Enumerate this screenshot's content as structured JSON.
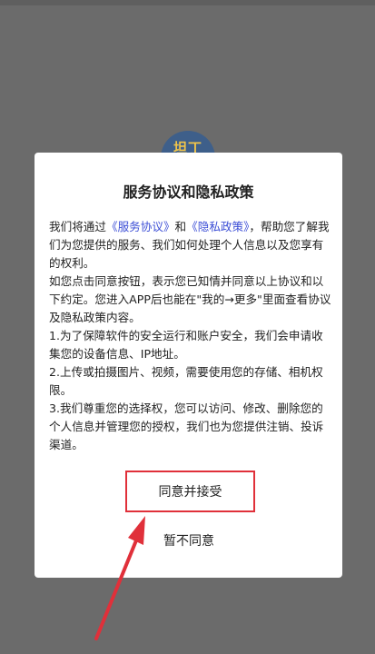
{
  "logo": {
    "text": "坦丁"
  },
  "dialog": {
    "title": "服务协议和隐私政策",
    "para1": {
      "prefix": "我们将通过",
      "link1": "《服务协议》",
      "mid": "和",
      "link2": "《隐私政策》",
      "suffix": "，帮助您了解我们为您提供的服务、我们如何处理个人信息以及您享有的权利。"
    },
    "para2": "如您点击同意按钮，表示您已知情并同意以上协议和以下约定。您进入APP后也能在\"我的→更多\"里面查看协议及隐私政策内容。",
    "para3": "1.为了保障软件的安全运行和账户安全，我们会申请收集您的设备信息、IP地址。",
    "para4": "2.上传或拍摄图片、视频，需要使用您的存储、相机权限。",
    "para5": "3.我们尊重您的选择权，您可以访问、修改、删除您的个人信息并管理您的授权，我们也为您提供注销、投诉渠道。",
    "accept_label": "同意并接受",
    "decline_label": "暂不同意"
  },
  "colors": {
    "overlay": "#6b6b6b",
    "link": "#3d4fd6",
    "highlight": "#e0303a"
  }
}
